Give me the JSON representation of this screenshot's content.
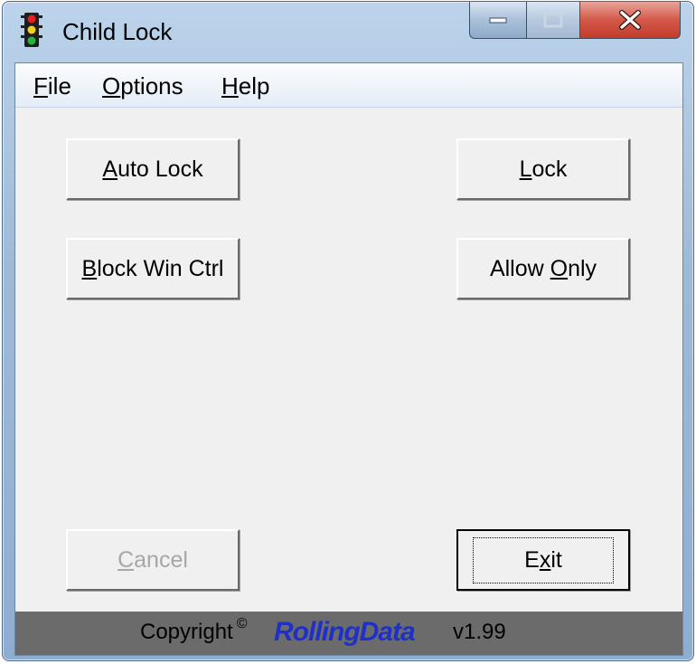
{
  "window": {
    "title": "Child Lock",
    "icon": "traffic-light-icon"
  },
  "caption": {
    "minimize_icon": "minimize-icon",
    "maximize_icon": "maximize-icon",
    "close_icon": "close-icon"
  },
  "menu": {
    "items": [
      {
        "mnemonic": "F",
        "rest": "ile"
      },
      {
        "mnemonic": "O",
        "rest": "ptions"
      },
      {
        "mnemonic": "H",
        "rest": "elp"
      }
    ]
  },
  "buttons": {
    "auto_lock": {
      "pre": "",
      "mnemonic": "A",
      "post": "uto Lock"
    },
    "lock": {
      "pre": "",
      "mnemonic": "L",
      "post": "ock"
    },
    "block_win_ctrl": {
      "pre": "",
      "mnemonic": "B",
      "post": "lock Win Ctrl"
    },
    "allow_only": {
      "pre": "Allow ",
      "mnemonic": "O",
      "post": "nly"
    },
    "cancel": {
      "pre": "",
      "mnemonic": "C",
      "post": "ancel"
    },
    "exit": {
      "pre": "E",
      "mnemonic": "x",
      "post": "it"
    }
  },
  "status": {
    "copyright": "Copyright",
    "copyright_symbol": "©",
    "brand": "RollingData",
    "version": "v1.99"
  },
  "colors": {
    "brand": "#1e30c8",
    "statusbar": "#6b6b6b",
    "close_button": "#c33c2a"
  }
}
